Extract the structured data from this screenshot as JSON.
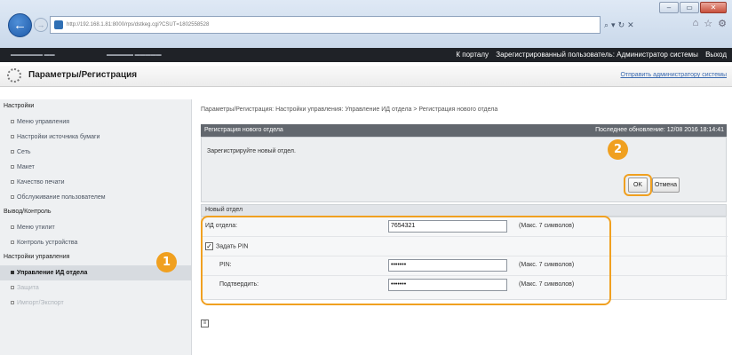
{
  "browser": {
    "url": "http://192.168.1.81:8000/rps/dstkeg.cgi?CSUT=1802558528",
    "search_icon": "search-icon",
    "window_buttons": [
      "–",
      "▭",
      "✕"
    ]
  },
  "topbar": {
    "portal_link": "К порталу",
    "user_label": "Зарегистрированный пользователь: Администратор системы",
    "logout": "Выход"
  },
  "header": {
    "title": "Параметры/Регистрация",
    "send_admin": "Отправить администратору системы"
  },
  "sidebar": {
    "sections": [
      {
        "heading": "Настройки",
        "items": [
          {
            "label": "Меню управления"
          },
          {
            "label": "Настройки источника бумаги"
          },
          {
            "label": "Сеть"
          },
          {
            "label": "Макет"
          },
          {
            "label": "Качество печати"
          },
          {
            "label": "Обслуживание пользователем"
          }
        ]
      },
      {
        "heading": "Вывод/Контроль",
        "items": [
          {
            "label": "Меню утилит"
          },
          {
            "label": "Контроль устройства"
          }
        ]
      },
      {
        "heading": "Настройки управления",
        "items": [
          {
            "label": "Управление ИД отдела"
          },
          {
            "label": "Защита"
          },
          {
            "label": "Импорт/Экспорт"
          }
        ]
      }
    ]
  },
  "main": {
    "breadcrumb": "Параметры/Регистрация: Настройки управления: Управление ИД отдела > Регистрация нового отдела",
    "panel_title": "Регистрация нового отдела",
    "last_updated": "Последнее обновление: 12/08 2016 18:14:41",
    "message": "Зарегистрируйте новый отдел.",
    "ok_label": "OK",
    "cancel_label": "Отмена",
    "section_title": "Новый отдел",
    "dept_id_label": "ИД отдела:",
    "dept_id_value": "7654321",
    "dept_id_hint": "(Макс. 7 символов)",
    "set_pin_label": "Задать PIN",
    "set_pin_checked": "✓",
    "pin_label": "PIN:",
    "pin_value": "•••••••",
    "pin_hint": "(Макс. 7 символов)",
    "confirm_label": "Подтвердить:",
    "confirm_value": "•••••••",
    "confirm_hint": "(Макс. 7 символов)"
  },
  "markers": {
    "one": "1",
    "two": "2"
  },
  "colors": {
    "accent": "#f0a020",
    "panel_header": "#62676e",
    "topbar": "#1f2227"
  }
}
